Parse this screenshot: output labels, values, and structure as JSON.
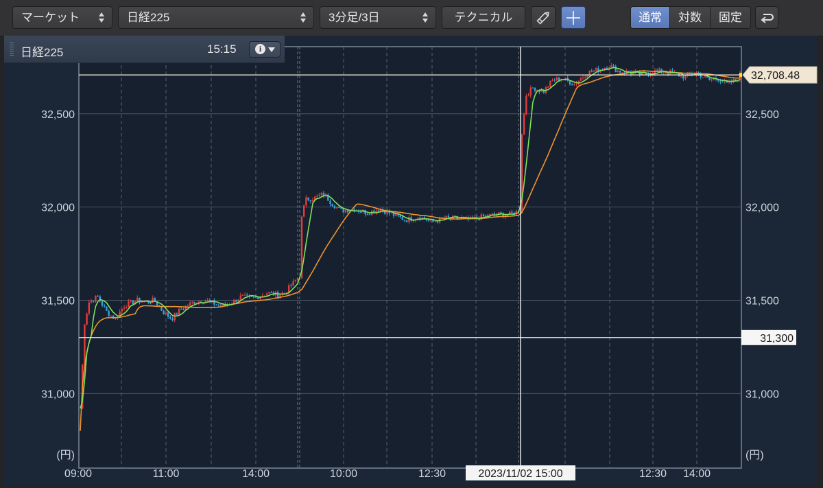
{
  "toolbar": {
    "market_label": "マーケット",
    "symbol_label": "日経225",
    "interval_label": "3分足/3日",
    "technical_label": "テクニカル",
    "scale_modes": [
      "通常",
      "対数",
      "固定"
    ],
    "active_scale": "通常"
  },
  "panel": {
    "title": "日経225",
    "time": "15:15"
  },
  "price_tags": {
    "current": "32,708.48",
    "hline": "31,300"
  },
  "crosshair_label": "2023/11/02 15:00",
  "colors": {
    "up": "#e23c3c",
    "down": "#3aa0d8",
    "ma_short": "#7ee35a",
    "ma_long": "#f0942e",
    "accent": "#6f8fcf"
  },
  "icons": {
    "drawing": "pencil-icon",
    "crosshair": "crosshair-icon",
    "undo": "undo-icon",
    "info": "info-icon"
  },
  "chart_data": {
    "type": "candlestick",
    "title": "日経225",
    "y_unit": "(円)",
    "ylim": [
      30600,
      32860
    ],
    "y_ticks": [
      31000,
      31500,
      32000,
      32500
    ],
    "y_tick_labels": [
      "31,000",
      "31,500",
      "32,000",
      "32,500"
    ],
    "x_tick_labels": [
      "09:00",
      "11:00",
      "14:00",
      "10:00",
      "12:30",
      "10:00",
      "12:30",
      "14:00"
    ],
    "days": [
      {
        "path": [
          [
            0,
            30920
          ],
          [
            2,
            31380
          ],
          [
            4,
            31490
          ],
          [
            8,
            31520
          ],
          [
            12,
            31440
          ],
          [
            16,
            31400
          ],
          [
            20,
            31470
          ],
          [
            26,
            31500
          ],
          [
            30,
            31490
          ],
          [
            34,
            31500
          ],
          [
            38,
            31440
          ],
          [
            42,
            31400
          ],
          [
            46,
            31450
          ],
          [
            52,
            31490
          ],
          [
            58,
            31500
          ],
          [
            62,
            31480
          ],
          [
            66,
            31470
          ],
          [
            70,
            31490
          ],
          [
            74,
            31520
          ],
          [
            78,
            31510
          ],
          [
            82,
            31520
          ],
          [
            86,
            31540
          ],
          [
            90,
            31530
          ],
          [
            94,
            31540
          ],
          [
            97,
            31580
          ],
          [
            100,
            31620
          ]
        ]
      },
      {
        "path": [
          [
            0,
            31960
          ],
          [
            2,
            32040
          ],
          [
            6,
            32050
          ],
          [
            10,
            32070
          ],
          [
            14,
            32020
          ],
          [
            18,
            31980
          ],
          [
            24,
            31990
          ],
          [
            30,
            31970
          ],
          [
            36,
            31990
          ],
          [
            42,
            31960
          ],
          [
            48,
            31930
          ],
          [
            54,
            31950
          ],
          [
            60,
            31920
          ],
          [
            66,
            31940
          ],
          [
            72,
            31940
          ],
          [
            78,
            31930
          ],
          [
            84,
            31950
          ],
          [
            90,
            31960
          ],
          [
            96,
            31960
          ],
          [
            100,
            31980
          ]
        ]
      },
      {
        "path": [
          [
            0,
            32400
          ],
          [
            2,
            32600
          ],
          [
            5,
            32640
          ],
          [
            10,
            32620
          ],
          [
            14,
            32680
          ],
          [
            18,
            32690
          ],
          [
            24,
            32660
          ],
          [
            30,
            32720
          ],
          [
            36,
            32740
          ],
          [
            40,
            32760
          ],
          [
            44,
            32730
          ],
          [
            50,
            32720
          ],
          [
            56,
            32710
          ],
          [
            62,
            32730
          ],
          [
            68,
            32720
          ],
          [
            74,
            32700
          ],
          [
            80,
            32720
          ],
          [
            86,
            32680
          ],
          [
            90,
            32690
          ],
          [
            94,
            32660
          ],
          [
            98,
            32680
          ],
          [
            100,
            32708
          ]
        ]
      }
    ],
    "current_price": 32708.48,
    "horizontal_line": 31300
  }
}
